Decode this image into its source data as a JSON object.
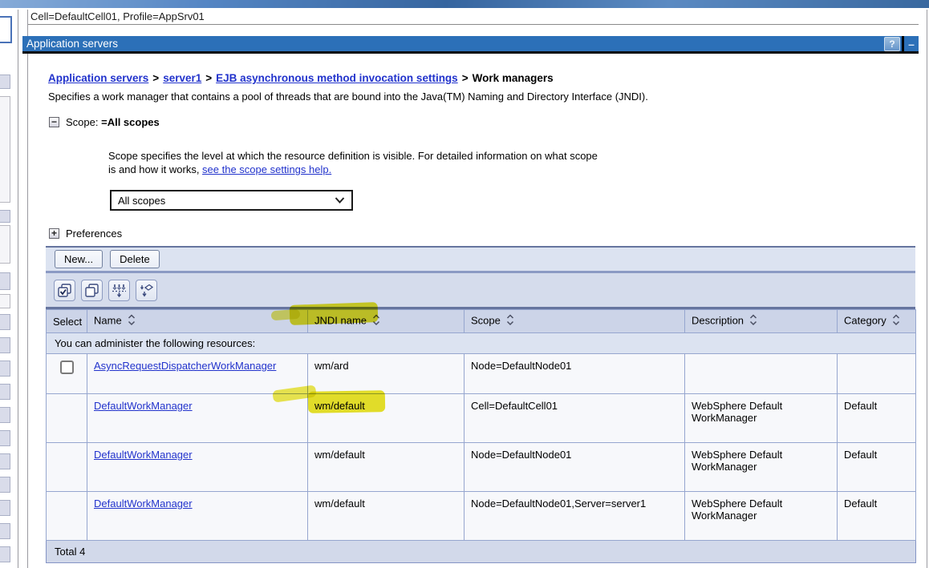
{
  "context_bar": {
    "text": "Cell=DefaultCell01, Profile=AppSrv01"
  },
  "window": {
    "title": "Application servers",
    "help": "?",
    "minimize": "–"
  },
  "breadcrumb": {
    "separator": ">",
    "items": [
      {
        "label": "Application servers",
        "link": true
      },
      {
        "label": "server1",
        "link": true
      },
      {
        "label": "EJB asynchronous method invocation settings",
        "link": true
      },
      {
        "label": "Work managers",
        "link": false
      }
    ]
  },
  "intro": {
    "text": "Specifies a work manager that contains a pool of threads that are bound into the Java(TM) Naming and Directory Interface (JNDI)."
  },
  "scope": {
    "toggle": "−",
    "label": "Scope:",
    "value": "=All scopes",
    "help_line1": "Scope specifies the level at which the resource definition is visible. For detailed information on what scope",
    "help_line2": "is and how it works, ",
    "help_link": "see the scope settings help.",
    "dropdown_value": "All scopes"
  },
  "preferences": {
    "toggle": "+",
    "label": "Preferences"
  },
  "actions": {
    "new": "New...",
    "delete": "Delete"
  },
  "icon_toolbar": {
    "icons": [
      {
        "name": "select-all-icon"
      },
      {
        "name": "deselect-all-icon"
      },
      {
        "name": "show-filter-icon"
      },
      {
        "name": "clear-filter-icon"
      }
    ]
  },
  "table": {
    "headers": [
      {
        "label": "Select",
        "sortable": false
      },
      {
        "label": "Name",
        "sortable": true
      },
      {
        "label": "JNDI name",
        "sortable": true,
        "highlighted": true
      },
      {
        "label": "Scope",
        "sortable": true
      },
      {
        "label": "Description",
        "sortable": true
      },
      {
        "label": "Category",
        "sortable": true
      }
    ],
    "admin_note": "You can administer the following resources:",
    "rows": [
      {
        "checkbox": true,
        "name": "AsyncRequestDispatcherWorkManager",
        "jndi": "wm/ard",
        "scope": "Node=DefaultNode01",
        "description": "",
        "category": ""
      },
      {
        "checkbox": false,
        "name": "DefaultWorkManager",
        "jndi": "wm/default",
        "jndi_highlighted": true,
        "scope": "Cell=DefaultCell01",
        "description": "WebSphere Default WorkManager",
        "category": "Default"
      },
      {
        "checkbox": false,
        "name": "DefaultWorkManager",
        "jndi": "wm/default",
        "scope": "Node=DefaultNode01",
        "description": "WebSphere Default WorkManager",
        "category": "Default"
      },
      {
        "checkbox": false,
        "name": "DefaultWorkManager",
        "jndi": "wm/default",
        "scope": "Node=DefaultNode01,Server=server1",
        "description": "WebSphere Default WorkManager",
        "category": "Default"
      }
    ],
    "total": "Total 4"
  },
  "colors": {
    "title_bar": "#2c70b8",
    "header_bg": "#ccd4e8",
    "toolbar_bg": "#dce3f1",
    "row_bg": "#f7f8fb",
    "table_border": "#96a6cf",
    "link": "#2233cc",
    "highlight": "#e5de04"
  }
}
